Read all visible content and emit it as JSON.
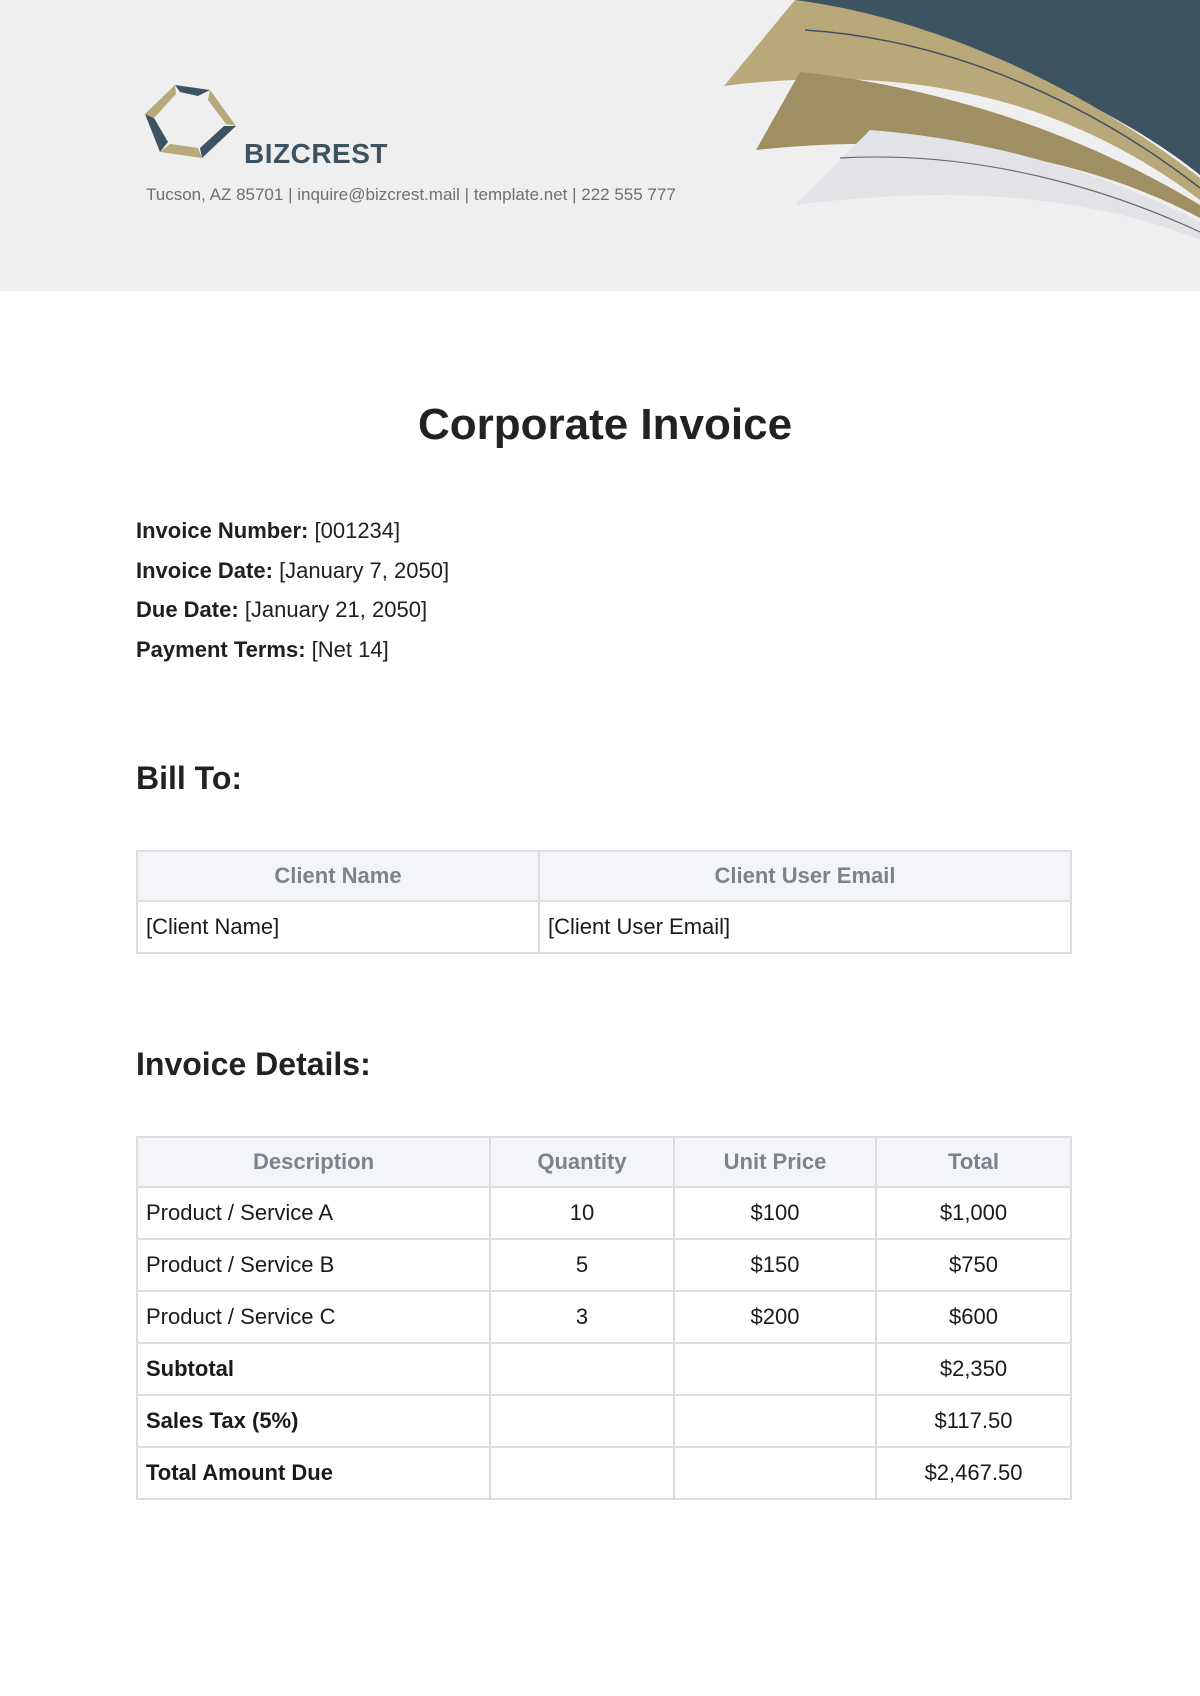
{
  "brand": {
    "name": "BIZCREST",
    "contact": "Tucson, AZ 85701 | inquire@bizcrest.mail | template.net | 222 555 777",
    "colors": {
      "navy": "#3d5361",
      "gold": "#b9a87a",
      "gold_dark": "#9f8f63",
      "header_bg": "#efefef"
    }
  },
  "document": {
    "title": "Corporate Invoice"
  },
  "meta": [
    {
      "label": "Invoice Number:",
      "value": "[001234]"
    },
    {
      "label": "Invoice Date:",
      "value": "[January 7, 2050]"
    },
    {
      "label": "Due Date:",
      "value": "[January 21, 2050]"
    },
    {
      "label": "Payment Terms:",
      "value": "[Net 14]"
    }
  ],
  "bill_to": {
    "heading": "Bill To:",
    "headers": [
      "Client Name",
      "Client User Email"
    ],
    "row": [
      "[Client Name]",
      "[Client User Email]"
    ]
  },
  "details": {
    "heading": "Invoice Details:",
    "headers": [
      "Description",
      "Quantity",
      "Unit Price",
      "Total"
    ],
    "rows": [
      [
        "Product / Service A",
        "10",
        "$100",
        "$1,000"
      ],
      [
        "Product / Service B",
        "5",
        "$150",
        "$750"
      ],
      [
        "Product / Service C",
        "3",
        "$200",
        "$600"
      ]
    ],
    "summary": [
      {
        "label": "Subtotal",
        "value": "$2,350"
      },
      {
        "label": "Sales Tax (5%)",
        "value": "$117.50"
      },
      {
        "label": "Total Amount Due",
        "value": "$2,467.50"
      }
    ]
  }
}
